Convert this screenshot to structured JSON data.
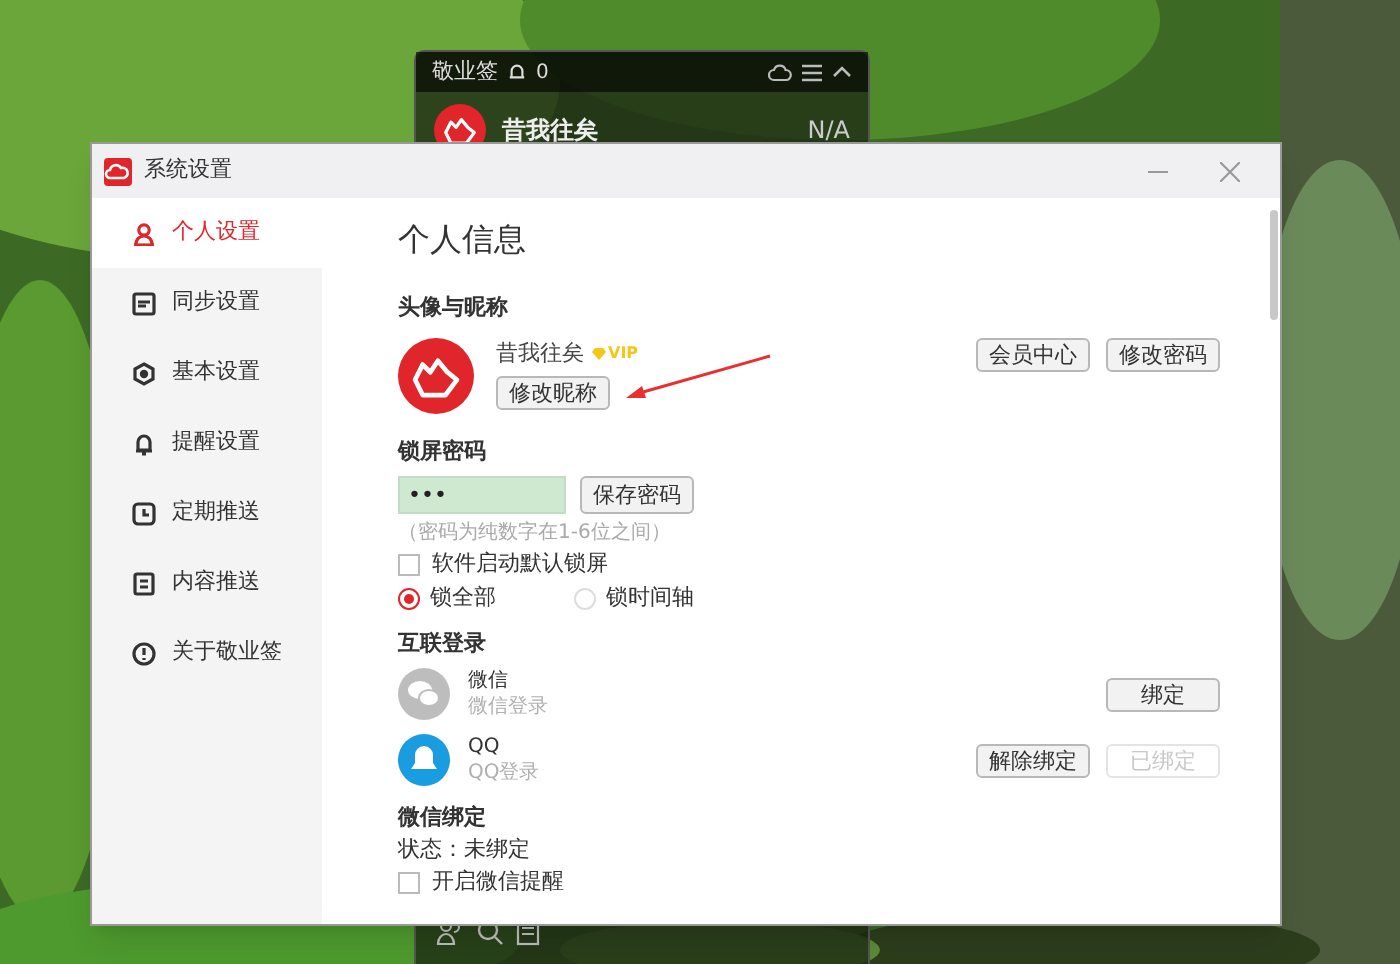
{
  "widget": {
    "title": "敬业签",
    "notification_count": "0",
    "user_name": "昔我往矣",
    "user_status": "N/A"
  },
  "settings": {
    "title": "系统设置",
    "sidebar": [
      {
        "label": "个人设置",
        "selected": true
      },
      {
        "label": "同步设置",
        "selected": false
      },
      {
        "label": "基本设置",
        "selected": false
      },
      {
        "label": "提醒设置",
        "selected": false
      },
      {
        "label": "定期推送",
        "selected": false
      },
      {
        "label": "内容推送",
        "selected": false
      },
      {
        "label": "关于敬业签",
        "selected": false
      }
    ],
    "heading": "个人信息",
    "profile": {
      "title": "头像与昵称",
      "name": "昔我往矣",
      "badge": "VIP",
      "rename_button": "修改昵称",
      "buttons": [
        "会员中心",
        "修改密码"
      ]
    },
    "lock": {
      "title": "锁屏密码",
      "value": "•••",
      "save_button": "保存密码",
      "hint": "（密码为纯数字在1-6位之间）",
      "auto_lock": {
        "label": "软件启动默认锁屏",
        "checked": false
      },
      "modes": [
        {
          "label": "锁全部",
          "selected": true
        },
        {
          "label": "锁时间轴",
          "selected": false
        }
      ]
    },
    "linked": {
      "title": "互联登录",
      "accounts": [
        {
          "kind": "wechat",
          "name": "微信",
          "subtitle": "微信登录",
          "buttons": [
            {
              "label": "绑定",
              "disabled": false
            }
          ]
        },
        {
          "kind": "qq",
          "name": "QQ",
          "subtitle": "QQ登录",
          "buttons": [
            {
              "label": "解除绑定",
              "disabled": false
            },
            {
              "label": "已绑定",
              "disabled": true
            }
          ]
        }
      ]
    },
    "wechat_bind": {
      "title": "微信绑定",
      "status": "状态：未绑定",
      "reminder": {
        "label": "开启微信提醒",
        "checked": false
      }
    }
  }
}
